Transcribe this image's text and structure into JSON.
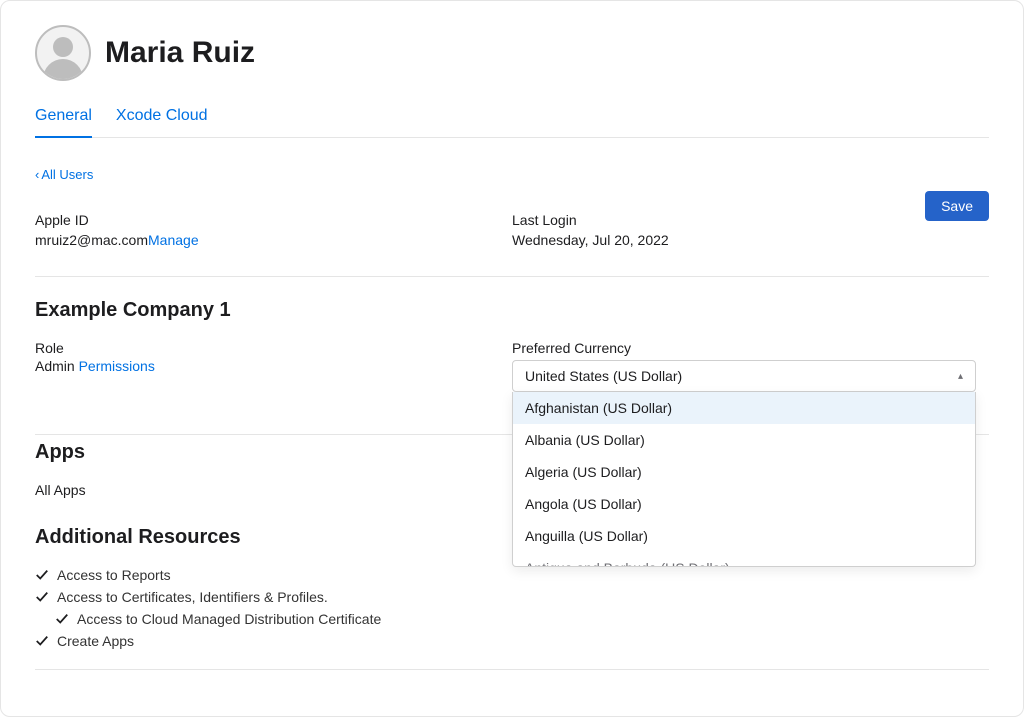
{
  "header": {
    "user_name": "Maria Ruiz"
  },
  "tabs": {
    "general": "General",
    "xcode": "Xcode Cloud"
  },
  "back_link": "All Users",
  "save_label": "Save",
  "apple_id": {
    "label": "Apple ID",
    "value": "mruiz2@mac.com",
    "manage": "Manage"
  },
  "last_login": {
    "label": "Last Login",
    "value": "Wednesday, Jul 20, 2022"
  },
  "company": {
    "name": "Example Company 1",
    "role_label": "Role",
    "role_value": "Admin ",
    "permissions_link": "Permissions"
  },
  "currency": {
    "label": "Preferred Currency",
    "selected": "United States (US Dollar)",
    "options": [
      "Afghanistan (US Dollar)",
      "Albania (US Dollar)",
      "Algeria (US Dollar)",
      "Angola (US Dollar)",
      "Anguilla (US Dollar)",
      "Antigua and Barbuda (US Dollar)"
    ]
  },
  "apps": {
    "title": "Apps",
    "value": "All Apps"
  },
  "additional": {
    "title": "Additional Resources",
    "items": [
      "Access to Reports",
      "Access to Certificates, Identifiers & Profiles.",
      "Access to Cloud Managed Distribution Certificate",
      "Create Apps"
    ]
  }
}
